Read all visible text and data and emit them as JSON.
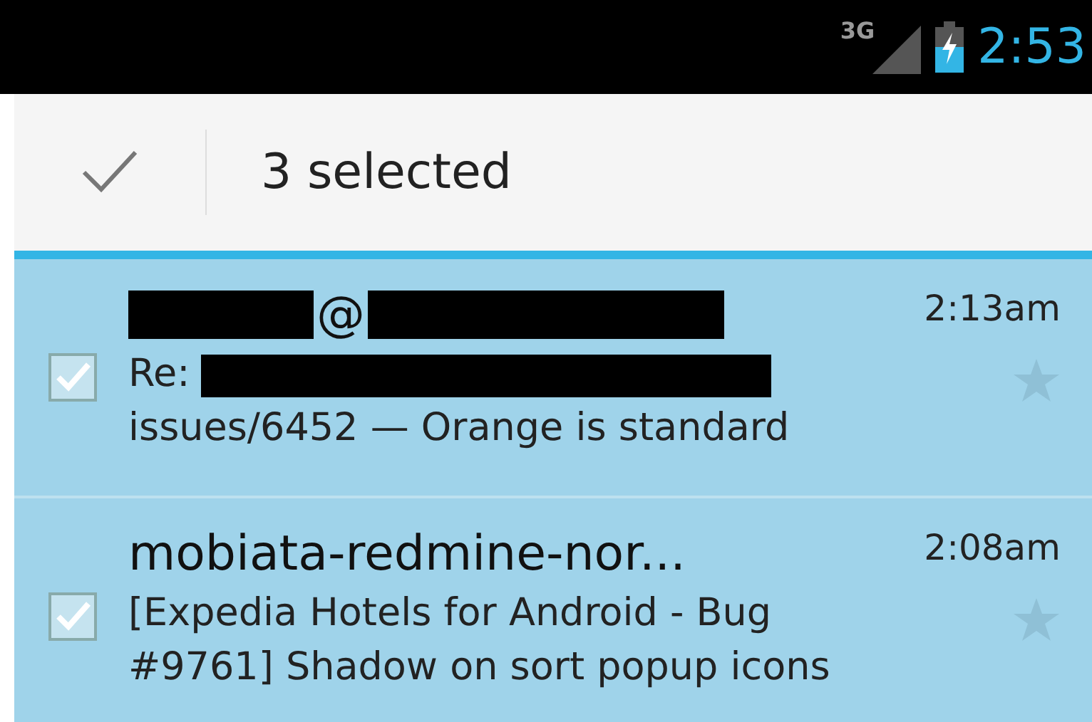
{
  "status_bar": {
    "network": "3G",
    "time": "2:53"
  },
  "action_bar": {
    "title": "3 selected"
  },
  "messages": [
    {
      "selected": true,
      "starred": false,
      "time": "2:13am",
      "sender": [
        {
          "kind": "redacted"
        },
        {
          "kind": "text",
          "text": "@"
        },
        {
          "kind": "redacted"
        }
      ],
      "subject": [
        {
          "kind": "text",
          "text": "Re:"
        },
        {
          "kind": "redacted"
        },
        {
          "kind": "break"
        },
        {
          "kind": "text",
          "text": "issues/6452 — Orange is standard"
        }
      ]
    },
    {
      "selected": true,
      "starred": false,
      "time": "2:08am",
      "sender": [
        {
          "kind": "text",
          "text": "mobiata-redmine-nor..."
        }
      ],
      "subject": [
        {
          "kind": "text",
          "text": "[Expedia Hotels for Android - Bug #9761] Shadow on sort popup icons"
        }
      ]
    }
  ]
}
